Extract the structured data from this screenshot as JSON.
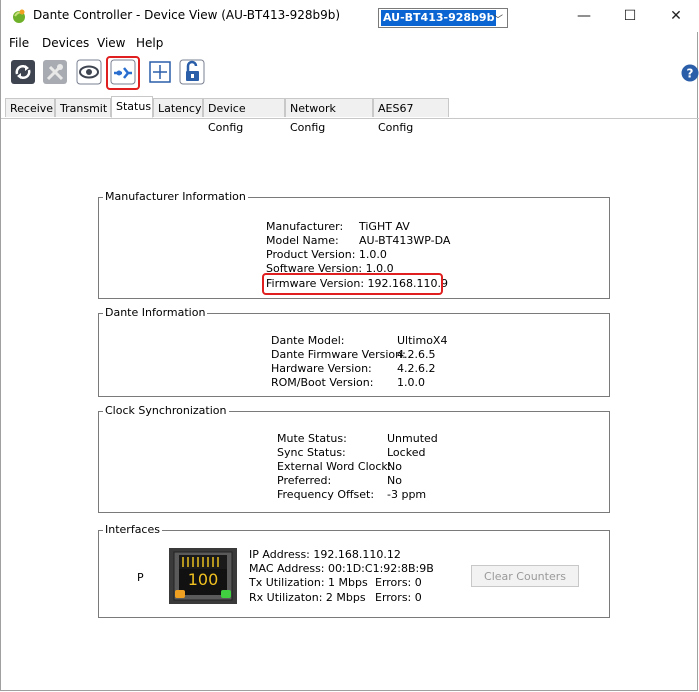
{
  "window": {
    "title": "Dante Controller - Device View (AU-BT413-928b9b)"
  },
  "menu": [
    "File",
    "Devices",
    "View",
    "Help"
  ],
  "device_selector": {
    "value": "AU-BT413-928b9b"
  },
  "tabs": [
    "Receive",
    "Transmit",
    "Status",
    "Latency",
    "Device Config",
    "Network Config",
    "AES67 Config"
  ],
  "active_tab": "Status",
  "manufacturer": {
    "title": "Manufacturer Information",
    "manufacturer_label": "Manufacturer:",
    "manufacturer_value": "TiGHT AV",
    "model_label": "Model Name:",
    "model_value": "AU-BT413WP-DA",
    "product_version": "Product Version:  1.0.0",
    "software_version": "Software Version: 1.0.0",
    "firmware_version": "Firmware Version: 192.168.110.9"
  },
  "dante": {
    "title": "Dante Information",
    "model_label": "Dante Model:",
    "model_value": "UltimoX4",
    "firmware_label": "Dante Firmware Version:",
    "firmware_value": "4.2.6.5",
    "hardware_label": "Hardware Version:",
    "hardware_value": "4.2.6.2",
    "rom_label": "ROM/Boot Version:",
    "rom_value": "1.0.0"
  },
  "clock": {
    "title": "Clock Synchronization",
    "mute_label": "Mute Status:",
    "mute_value": "Unmuted",
    "sync_label": "Sync Status:",
    "sync_value": "Locked",
    "ext_label": "External Word Clock:",
    "ext_value": "No",
    "pref_label": "Preferred:",
    "pref_value": "No",
    "freq_label": "Frequency Offset:",
    "freq_value": "-3 ppm"
  },
  "interfaces": {
    "title": "Interfaces",
    "port_label": "P",
    "link_speed": "100",
    "ip": "IP Address:   192.168.110.12",
    "mac": "MAC Address: 00:1D:C1:92:8B:9B",
    "tx_label": "Tx Utilization:  1 Mbps",
    "tx_errors": "Errors: 0",
    "rx_label": "Rx Utilizaton:  2 Mbps",
    "rx_errors": "Errors: 0",
    "clear_button": "Clear Counters"
  }
}
